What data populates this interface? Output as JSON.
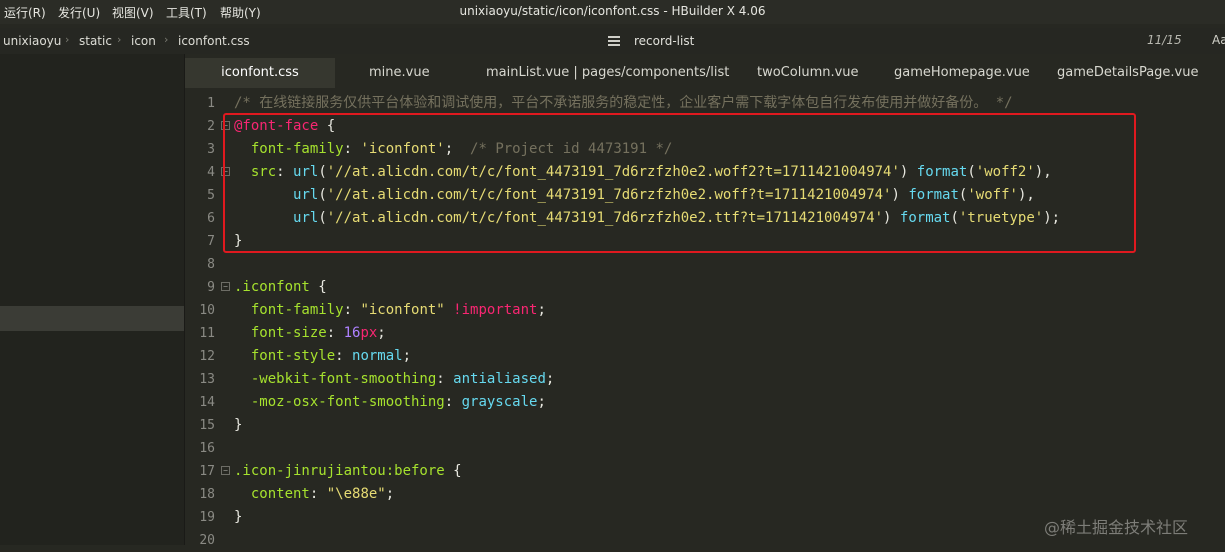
{
  "menu": [
    "运行(R)",
    "发行(U)",
    "视图(V)",
    "工具(T)",
    "帮助(Y)"
  ],
  "window_title": "unixiaoyu/static/icon/iconfont.css - HBuilder X 4.06",
  "breadcrumb": [
    "unixiaoyu",
    "static",
    "icon",
    "iconfont.css"
  ],
  "outline_label": "record-list",
  "page_count": "11/15",
  "font_button": "Aa",
  "tabs": [
    "iconfont.css",
    "mine.vue",
    "mainList.vue | pages/components/list",
    "twoColumn.vue",
    "gameHomepage.vue",
    "gameDetailsPage.vue"
  ],
  "code": {
    "comment_line": "/* 在线链接服务仅供平台体验和调试使用，平台不承诺服务的稳定性，企业客户需下载字体包自行发布使用并做好备份。 */",
    "at_rule": "@font-face",
    "font_family_prop": "font-family",
    "iconfont_str": "'iconfont'",
    "project_comment": "/* Project id 4473191 */",
    "src_prop": "src",
    "url_fn": "url",
    "url_woff2": "'//at.alicdn.com/t/c/font_4473191_7d6rzfzh0e2.woff2?t=1711421004974'",
    "url_woff": "'//at.alicdn.com/t/c/font_4473191_7d6rzfzh0e2.woff?t=1711421004974'",
    "url_ttf": "'//at.alicdn.com/t/c/font_4473191_7d6rzfzh0e2.ttf?t=1711421004974'",
    "format_fn": "format",
    "fmt_woff2": "'woff2'",
    "fmt_woff": "'woff'",
    "fmt_truetype": "'truetype'",
    "iconfont_selector": ".iconfont",
    "iconfont_dq": "\"iconfont\"",
    "important": "!important",
    "font_size_prop": "font-size",
    "font_size_num": "16",
    "font_size_unit": "px",
    "font_style_prop": "font-style",
    "normal_val": "normal",
    "webkit_prop": "-webkit-font-smoothing",
    "antialiased_val": "antialiased",
    "moz_prop": "-moz-osx-font-smoothing",
    "grayscale_val": "grayscale",
    "icon_selector": ".icon-jinrujiantou:before",
    "content_prop": "content",
    "content_val": "\"\\e88e\"",
    "line_numbers": [
      "1",
      "2",
      "3",
      "4",
      "5",
      "6",
      "7",
      "8",
      "9",
      "10",
      "11",
      "12",
      "13",
      "14",
      "15",
      "16",
      "17",
      "18",
      "19",
      "20"
    ]
  },
  "watermark": "@稀土掘金技术社区",
  "colors": {
    "background": "#272822",
    "highlight_box": "#e0191f",
    "comment": "#75715e",
    "keyword": "#f92672",
    "property": "#a6e22e",
    "string": "#e6db74",
    "function": "#66d9ef",
    "number": "#ae81ff"
  }
}
